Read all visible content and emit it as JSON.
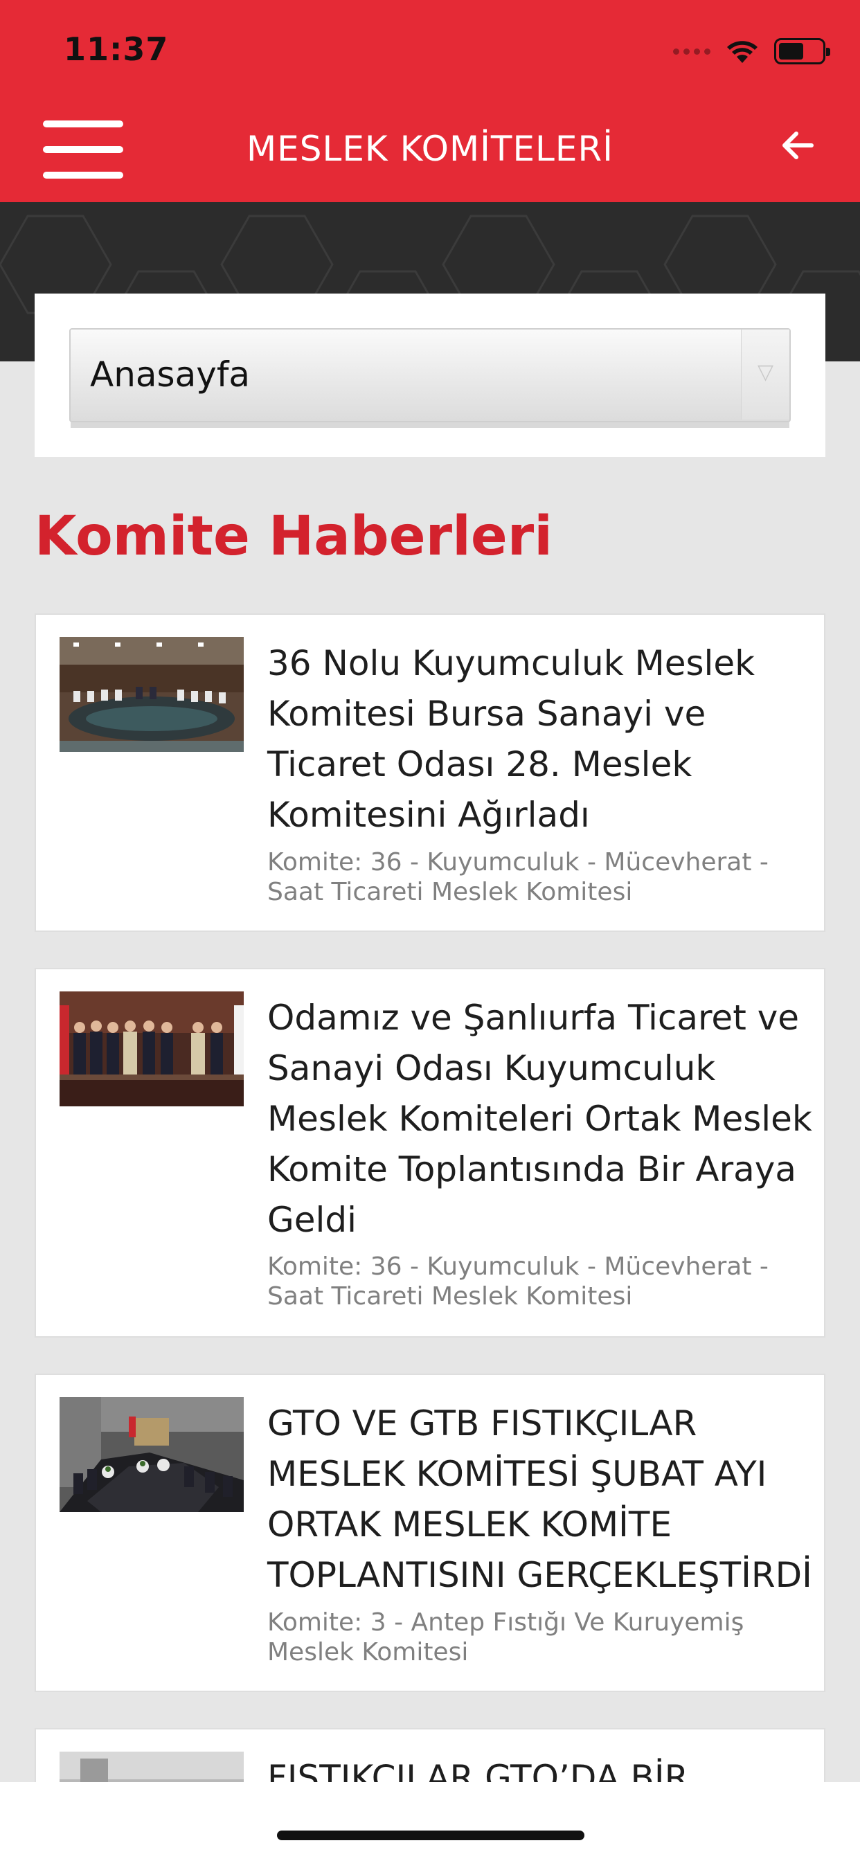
{
  "status_bar": {
    "time": "11:37"
  },
  "header": {
    "title": "MESLEK KOMİTELERİ"
  },
  "filter": {
    "selected": "Anasayfa"
  },
  "section": {
    "title": "Komite Haberleri"
  },
  "news": [
    {
      "title": "36 Nolu Kuyumculuk Meslek Komitesi Bursa Sanayi ve Ticaret Odası 28. Meslek Komitesini Ağırladı",
      "meta": "Komite: 36 - Kuyumculuk - Mücevherat - Saat Ticareti Meslek Komitesi"
    },
    {
      "title": "Odamız ve Şanlıurfa Ticaret ve Sanayi Odası Kuyumculuk Meslek Komiteleri Ortak Meslek Komite Toplantısında Bir Araya Geldi",
      "meta": "Komite: 36 - Kuyumculuk - Mücevherat - Saat Ticareti Meslek Komitesi"
    },
    {
      "title": "GTO VE GTB FISTIKÇILAR MESLEK KOMİTESİ ŞUBAT AYI ORTAK MESLEK KOMİTE TOPLANTISINI GERÇEKLEŞTİRDİ",
      "meta": "Komite: 3 - Antep Fıstığı Ve Kuruyemiş Meslek Komitesi"
    },
    {
      "title": "FISTIKÇILAR GTO’DA BİR",
      "meta": ""
    }
  ],
  "colors": {
    "brand_red": "#e52a36",
    "title_red": "#d3222d"
  }
}
